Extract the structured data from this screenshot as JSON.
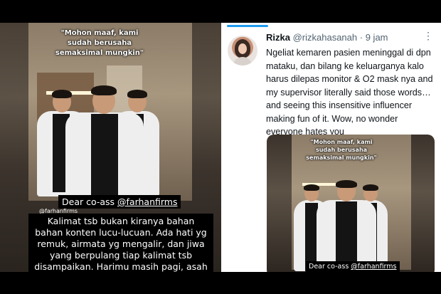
{
  "left_video": {
    "overlay_quote": "\"Mohon maaf, kami sudah berusaha semaksimal mungkin\"",
    "caption_prefix": "Dear co-ass ",
    "caption_handle": "@farhanfirms",
    "watermark_handle": "@farhanfirms",
    "body_text": "Kalimat tsb bukan kiranya bahan bahan konten lucu-lucuan. Ada hati yg remuk, airmata yg mengalir, dan jiwa yang berpulang tiap kalimat tsb disampaikan. Harimu masih pagi, asah empati dan nurani"
  },
  "tweet": {
    "author_name": "Rizka",
    "author_handle": "@rizkahasanah",
    "separator": "·",
    "time": "9 jam",
    "more_icon": "more-dots-icon",
    "text": "Ngeliat kemaren pasien meninggal di dpn mataku, dan bilang ke keluarganya kalo harus dilepas monitor & O2 mask nya and my supervisor  literally said those words… and seeing this insensitive influencer making fun of it. Wow, no wonder everyone hates you",
    "media": {
      "overlay_quote": "\"Mohon maaf, kami sudah berusaha semaksimal mungkin\"",
      "caption_prefix": "Dear co-ass ",
      "caption_handle": "@farhanfirms"
    }
  },
  "colors": {
    "accent": "#1d9bf0",
    "text_primary": "#0f1419",
    "text_secondary": "#536471"
  }
}
